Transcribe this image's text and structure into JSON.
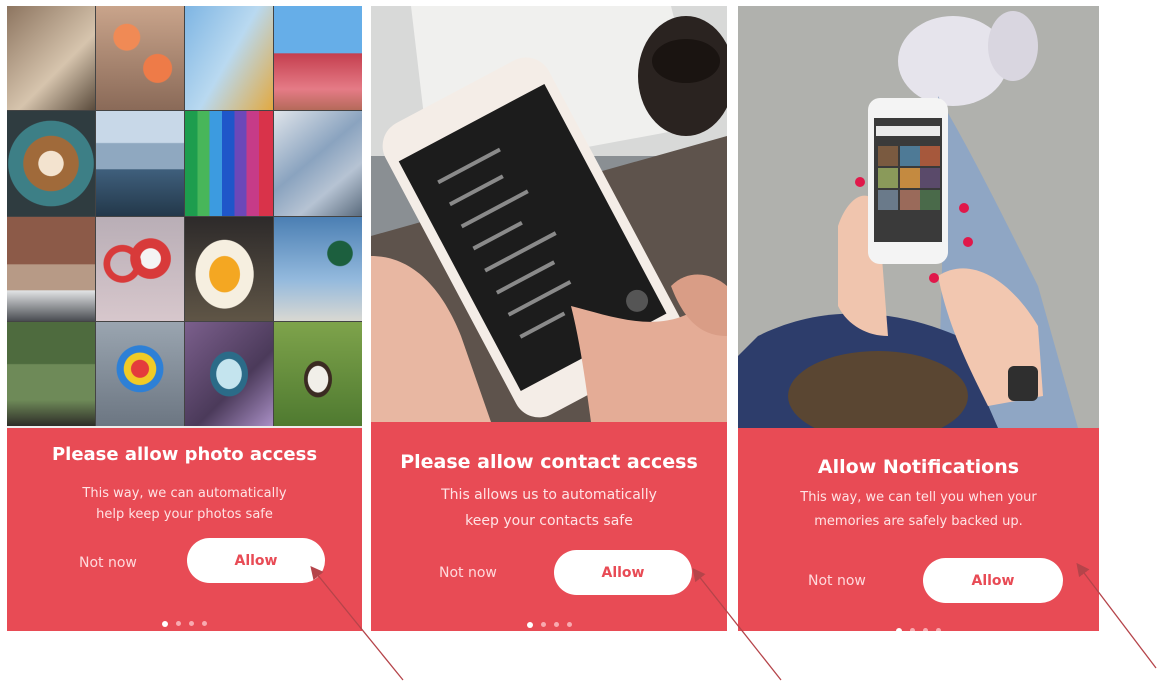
{
  "colors": {
    "accent": "#e84b55",
    "allow_text": "#e84b55"
  },
  "panels": [
    {
      "title": "Please allow photo access",
      "description_line1": "This way, we can automatically",
      "description_line2": "help keep your photos safe",
      "not_now_label": "Not now",
      "allow_label": "Allow",
      "dots": 4,
      "active_dot": 0
    },
    {
      "title": "Please allow contact access",
      "description_line1": "This allows us to automatically",
      "description_line2": "keep your contacts safe",
      "not_now_label": "Not now",
      "allow_label": "Allow",
      "dots": 4,
      "active_dot": 0
    },
    {
      "title": "Allow Notifications",
      "description_line1": "This way, we can tell you when your",
      "description_line2": "memories are safely backed up.",
      "not_now_label": "Not now",
      "allow_label": "Allow",
      "dots": 4,
      "active_dot": 0
    }
  ]
}
